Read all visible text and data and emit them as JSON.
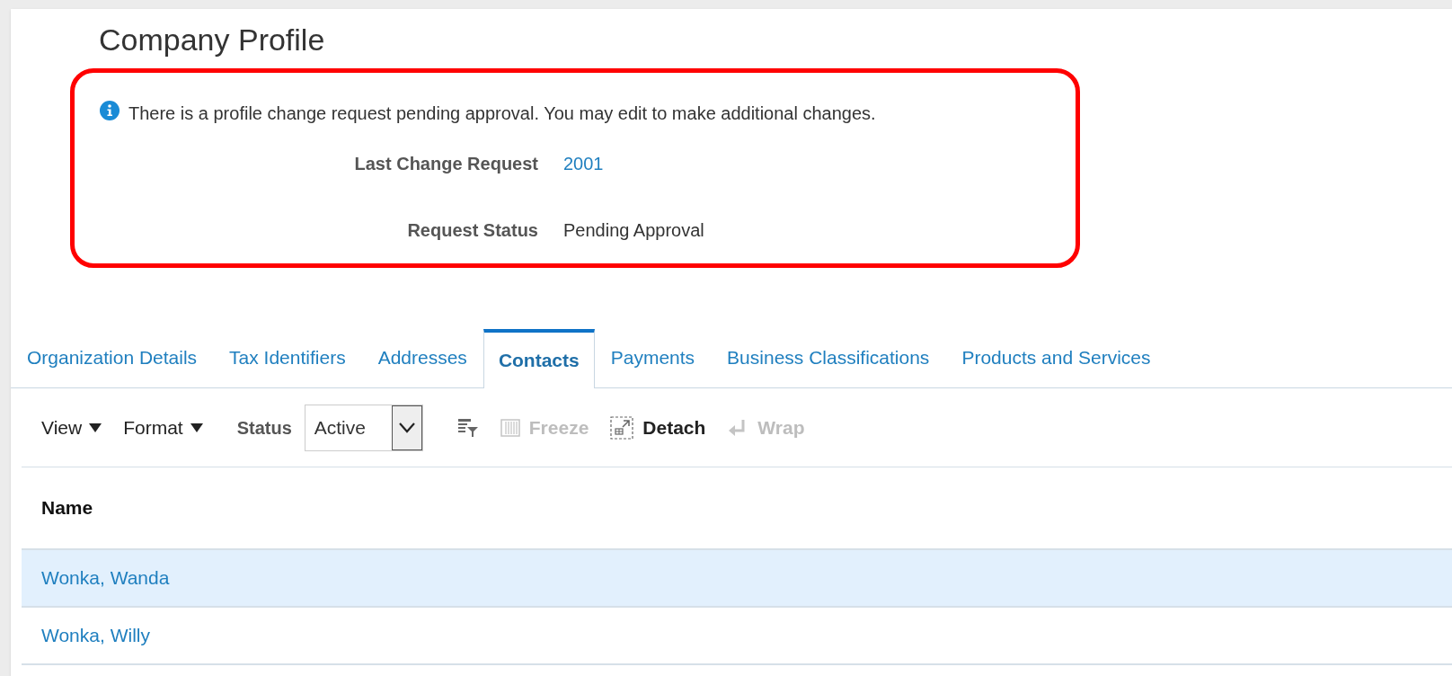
{
  "page_title": "Company Profile",
  "notice": {
    "message": "There is a profile change request pending approval. You may edit to make additional changes.",
    "fields": [
      {
        "label": "Last Change Request",
        "value": "2001",
        "kind": "link"
      },
      {
        "label": "Request Status",
        "value": "Pending Approval",
        "kind": "text"
      }
    ]
  },
  "tabs": [
    {
      "label": "Organization Details",
      "selected": false
    },
    {
      "label": "Tax Identifiers",
      "selected": false
    },
    {
      "label": "Addresses",
      "selected": false
    },
    {
      "label": "Contacts",
      "selected": true
    },
    {
      "label": "Payments",
      "selected": false
    },
    {
      "label": "Business Classifications",
      "selected": false
    },
    {
      "label": "Products and Services",
      "selected": false
    }
  ],
  "toolbar": {
    "menus": [
      {
        "label": "View"
      },
      {
        "label": "Format"
      }
    ],
    "status_filter": {
      "label": "Status",
      "value": "Active"
    },
    "actions": [
      {
        "kind": "filter",
        "disabled": false
      },
      {
        "kind": "freeze",
        "label": "Freeze",
        "disabled": true
      },
      {
        "kind": "detach",
        "label": "Detach",
        "disabled": false
      },
      {
        "kind": "wrap",
        "label": "Wrap",
        "disabled": true
      }
    ]
  },
  "table": {
    "columns": [
      "Name"
    ],
    "rows": [
      {
        "name": "Wonka, Wanda",
        "selected": true
      },
      {
        "name": "Wonka, Willy",
        "selected": false
      }
    ]
  }
}
